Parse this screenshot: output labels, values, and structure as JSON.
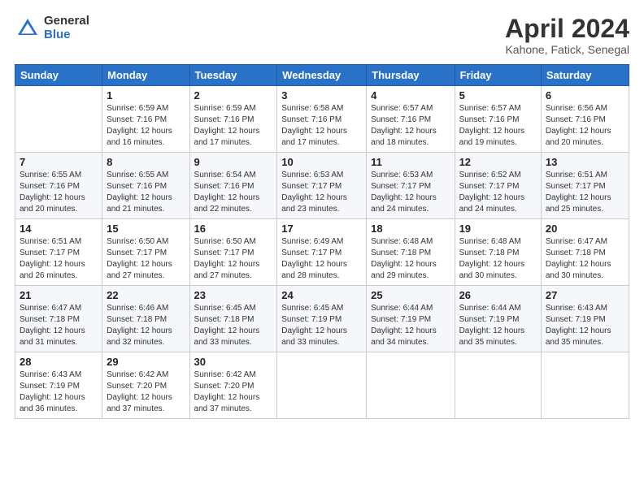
{
  "logo": {
    "general": "General",
    "blue": "Blue"
  },
  "title": {
    "main": "April 2024",
    "sub": "Kahone, Fatick, Senegal"
  },
  "weekdays": [
    "Sunday",
    "Monday",
    "Tuesday",
    "Wednesday",
    "Thursday",
    "Friday",
    "Saturday"
  ],
  "weeks": [
    [
      {
        "day": "",
        "info": ""
      },
      {
        "day": "1",
        "info": "Sunrise: 6:59 AM\nSunset: 7:16 PM\nDaylight: 12 hours and 16 minutes."
      },
      {
        "day": "2",
        "info": "Sunrise: 6:59 AM\nSunset: 7:16 PM\nDaylight: 12 hours and 17 minutes."
      },
      {
        "day": "3",
        "info": "Sunrise: 6:58 AM\nSunset: 7:16 PM\nDaylight: 12 hours and 17 minutes."
      },
      {
        "day": "4",
        "info": "Sunrise: 6:57 AM\nSunset: 7:16 PM\nDaylight: 12 hours and 18 minutes."
      },
      {
        "day": "5",
        "info": "Sunrise: 6:57 AM\nSunset: 7:16 PM\nDaylight: 12 hours and 19 minutes."
      },
      {
        "day": "6",
        "info": "Sunrise: 6:56 AM\nSunset: 7:16 PM\nDaylight: 12 hours and 20 minutes."
      }
    ],
    [
      {
        "day": "7",
        "info": "Sunrise: 6:55 AM\nSunset: 7:16 PM\nDaylight: 12 hours and 20 minutes."
      },
      {
        "day": "8",
        "info": "Sunrise: 6:55 AM\nSunset: 7:16 PM\nDaylight: 12 hours and 21 minutes."
      },
      {
        "day": "9",
        "info": "Sunrise: 6:54 AM\nSunset: 7:16 PM\nDaylight: 12 hours and 22 minutes."
      },
      {
        "day": "10",
        "info": "Sunrise: 6:53 AM\nSunset: 7:17 PM\nDaylight: 12 hours and 23 minutes."
      },
      {
        "day": "11",
        "info": "Sunrise: 6:53 AM\nSunset: 7:17 PM\nDaylight: 12 hours and 24 minutes."
      },
      {
        "day": "12",
        "info": "Sunrise: 6:52 AM\nSunset: 7:17 PM\nDaylight: 12 hours and 24 minutes."
      },
      {
        "day": "13",
        "info": "Sunrise: 6:51 AM\nSunset: 7:17 PM\nDaylight: 12 hours and 25 minutes."
      }
    ],
    [
      {
        "day": "14",
        "info": "Sunrise: 6:51 AM\nSunset: 7:17 PM\nDaylight: 12 hours and 26 minutes."
      },
      {
        "day": "15",
        "info": "Sunrise: 6:50 AM\nSunset: 7:17 PM\nDaylight: 12 hours and 27 minutes."
      },
      {
        "day": "16",
        "info": "Sunrise: 6:50 AM\nSunset: 7:17 PM\nDaylight: 12 hours and 27 minutes."
      },
      {
        "day": "17",
        "info": "Sunrise: 6:49 AM\nSunset: 7:17 PM\nDaylight: 12 hours and 28 minutes."
      },
      {
        "day": "18",
        "info": "Sunrise: 6:48 AM\nSunset: 7:18 PM\nDaylight: 12 hours and 29 minutes."
      },
      {
        "day": "19",
        "info": "Sunrise: 6:48 AM\nSunset: 7:18 PM\nDaylight: 12 hours and 30 minutes."
      },
      {
        "day": "20",
        "info": "Sunrise: 6:47 AM\nSunset: 7:18 PM\nDaylight: 12 hours and 30 minutes."
      }
    ],
    [
      {
        "day": "21",
        "info": "Sunrise: 6:47 AM\nSunset: 7:18 PM\nDaylight: 12 hours and 31 minutes."
      },
      {
        "day": "22",
        "info": "Sunrise: 6:46 AM\nSunset: 7:18 PM\nDaylight: 12 hours and 32 minutes."
      },
      {
        "day": "23",
        "info": "Sunrise: 6:45 AM\nSunset: 7:18 PM\nDaylight: 12 hours and 33 minutes."
      },
      {
        "day": "24",
        "info": "Sunrise: 6:45 AM\nSunset: 7:19 PM\nDaylight: 12 hours and 33 minutes."
      },
      {
        "day": "25",
        "info": "Sunrise: 6:44 AM\nSunset: 7:19 PM\nDaylight: 12 hours and 34 minutes."
      },
      {
        "day": "26",
        "info": "Sunrise: 6:44 AM\nSunset: 7:19 PM\nDaylight: 12 hours and 35 minutes."
      },
      {
        "day": "27",
        "info": "Sunrise: 6:43 AM\nSunset: 7:19 PM\nDaylight: 12 hours and 35 minutes."
      }
    ],
    [
      {
        "day": "28",
        "info": "Sunrise: 6:43 AM\nSunset: 7:19 PM\nDaylight: 12 hours and 36 minutes."
      },
      {
        "day": "29",
        "info": "Sunrise: 6:42 AM\nSunset: 7:20 PM\nDaylight: 12 hours and 37 minutes."
      },
      {
        "day": "30",
        "info": "Sunrise: 6:42 AM\nSunset: 7:20 PM\nDaylight: 12 hours and 37 minutes."
      },
      {
        "day": "",
        "info": ""
      },
      {
        "day": "",
        "info": ""
      },
      {
        "day": "",
        "info": ""
      },
      {
        "day": "",
        "info": ""
      }
    ]
  ]
}
